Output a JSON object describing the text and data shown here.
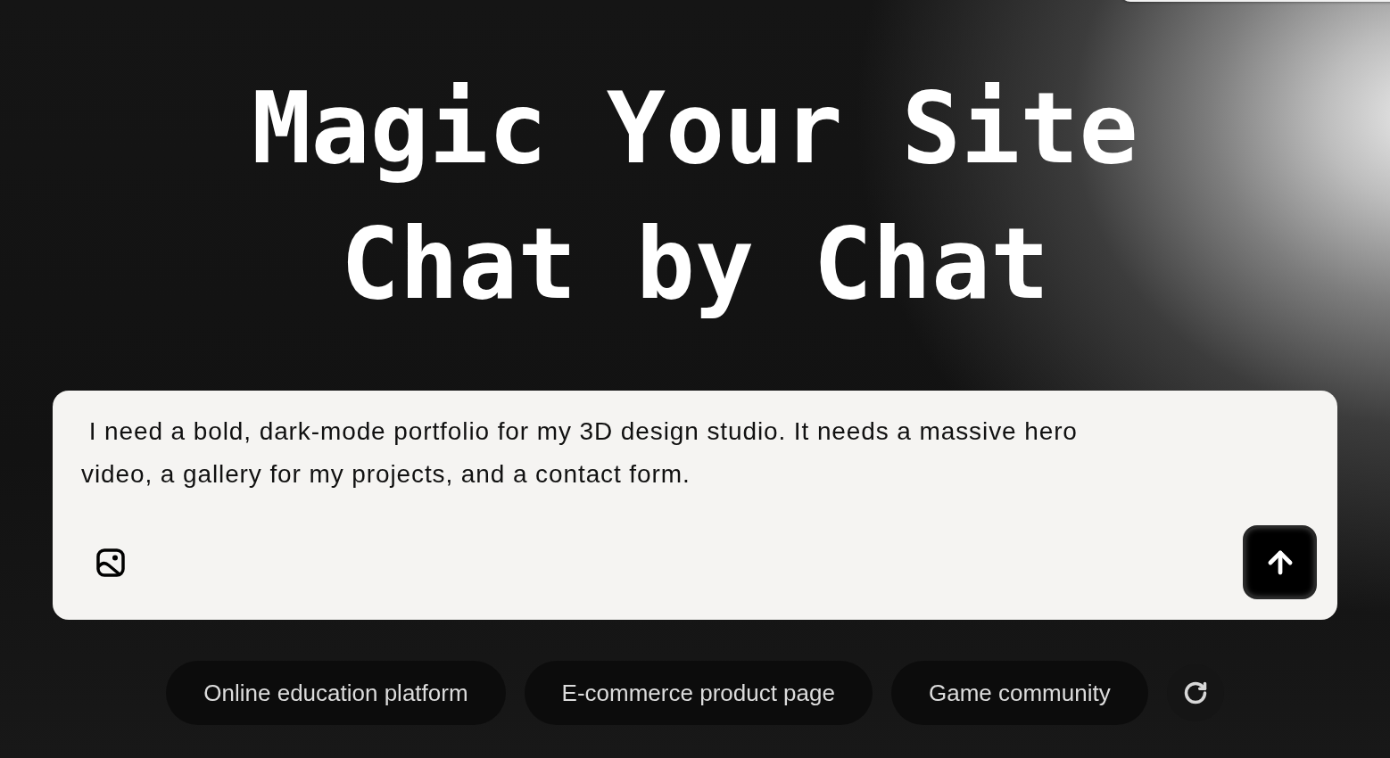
{
  "headline": {
    "lines": [
      "Magic Your Site",
      "Chat by Chat"
    ]
  },
  "prompt": {
    "value": " I need a bold, dark-mode portfolio for my 3D design studio. It needs a massive hero video, a gallery for my projects, and a contact form."
  },
  "suggestions": [
    "Online education platform",
    "E-commerce product page",
    "Game community"
  ]
}
